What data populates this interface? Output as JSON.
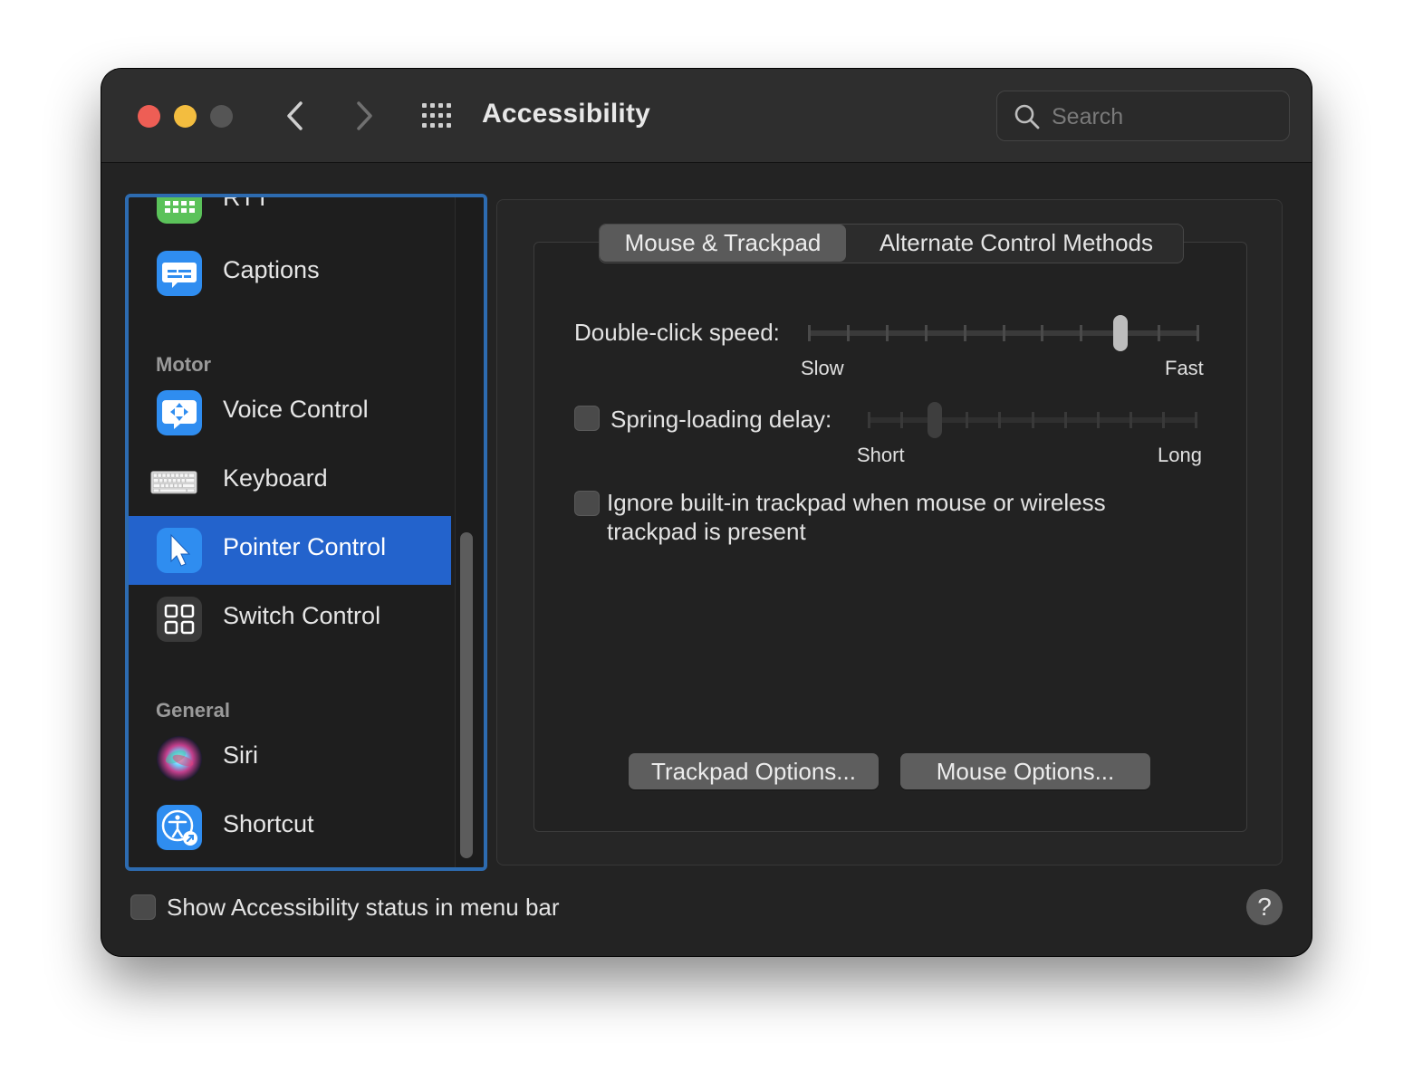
{
  "window": {
    "title": "Accessibility"
  },
  "search": {
    "placeholder": "Search"
  },
  "sidebar": {
    "partial_item": "RTT",
    "items": [
      {
        "label": "Captions"
      },
      {
        "label": "Voice Control"
      },
      {
        "label": "Keyboard"
      },
      {
        "label": "Pointer Control",
        "selected": true
      },
      {
        "label": "Switch Control"
      },
      {
        "label": "Siri"
      },
      {
        "label": "Shortcut"
      }
    ],
    "sections": {
      "motor": "Motor",
      "general": "General"
    }
  },
  "tabs": {
    "active": "Mouse & Trackpad",
    "other": "Alternate Control Methods"
  },
  "double_click": {
    "label": "Double-click speed:",
    "min_label": "Slow",
    "max_label": "Fast",
    "value_step": 8,
    "steps": 11
  },
  "spring_loading": {
    "label": "Spring-loading delay:",
    "min_label": "Short",
    "max_label": "Long",
    "checked": false,
    "value_step": 2,
    "steps": 11
  },
  "ignore_trackpad": {
    "label_line1": "Ignore built-in trackpad when mouse or wireless",
    "label_line2": "trackpad is present",
    "checked": false
  },
  "buttons": {
    "trackpad_options": "Trackpad Options...",
    "mouse_options": "Mouse Options..."
  },
  "footer": {
    "show_status_label": "Show Accessibility status in menu bar",
    "show_status_checked": false,
    "help_label": "?"
  },
  "colors": {
    "selection": "#2363cc",
    "sidebar_focus": "#2d6bb0"
  }
}
